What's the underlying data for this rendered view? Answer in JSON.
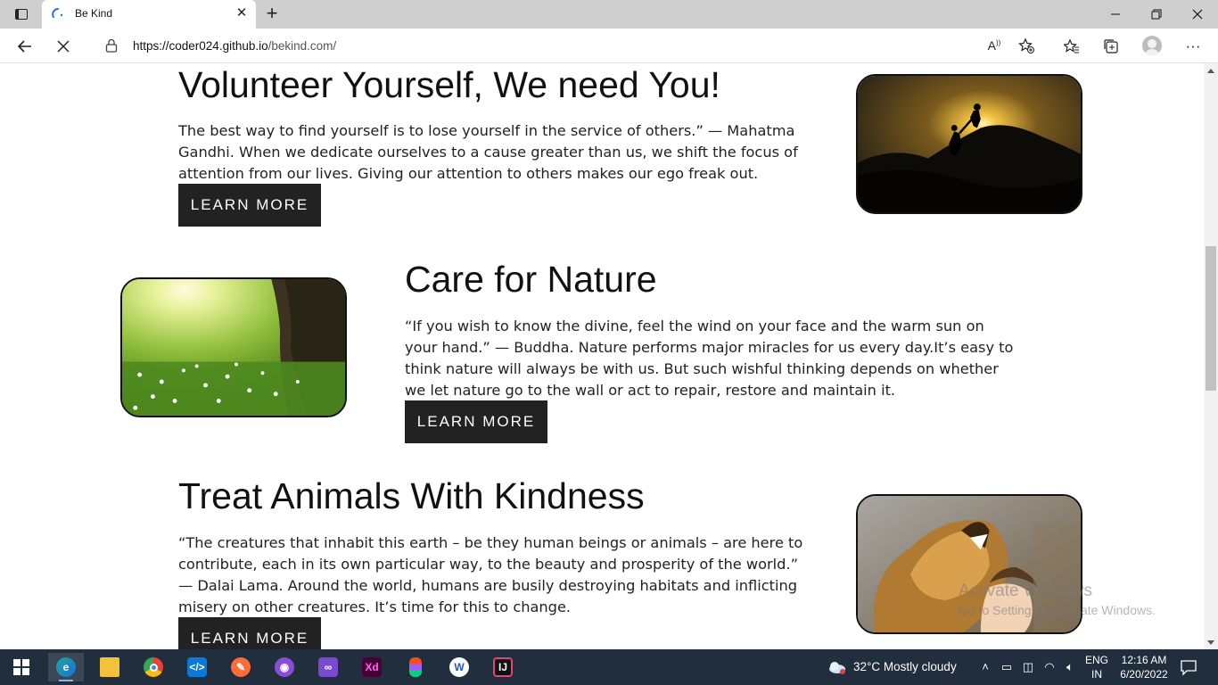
{
  "browser": {
    "tab_title": "Be Kind",
    "url_host": "https://coder024.github.io",
    "url_path": "/bekind.com/"
  },
  "sections": [
    {
      "title": "Volunteer Yourself, We need You!",
      "text": "The best way to find yourself is to lose yourself in the service of others.” — Mahatma Gandhi. When we dedicate ourselves to a cause greater than us, we shift the focus of attention from our lives. Giving our attention to others makes our ego freak out.",
      "button": "LEARN MORE",
      "image": "silhouettes helping each other climb at sunset"
    },
    {
      "title": "Care for Nature",
      "text": "“If you wish to know the divine, feel the wind on your face and the warm sun on your hand.” — Buddha. Nature performs major miracles for us every day.It’s easy to think nature will always be with us. But such wishful thinking depends on whether we let nature go to the wall or act to repair, restore and maintain it.",
      "button": "LEARN MORE",
      "image": "sunlit meadow with white flowers and tree"
    },
    {
      "title": "Treat Animals With Kindness",
      "text": "“The creatures that inhabit this earth – be they human beings or animals – are here to contribute, each in its own particular way, to the beauty and prosperity of the world.” — Dalai Lama. Around the world, humans are busily destroying habitats and inflicting misery on other creatures. It’s time for this to change.",
      "button": "LEARN MORE",
      "image": "lion roaring beside a smiling person"
    }
  ],
  "watermark": {
    "line1": "Activate Windows",
    "line2": "Go to Settings to activate Windows."
  },
  "taskbar": {
    "weather": "32°C  Mostly cloudy",
    "lang_top": "ENG",
    "lang_bottom": "IN",
    "time": "12:16 AM",
    "date": "6/20/2022",
    "apps": [
      "edge-icon",
      "file-explorer-icon",
      "chrome-icon",
      "vscode-icon",
      "postman-icon",
      "github-desktop-icon",
      "visual-studio-icon",
      "adobe-xd-icon",
      "figma-icon",
      "word-icon",
      "intellij-icon"
    ]
  },
  "colors": {
    "taskbar": "#202e3e",
    "button": "#222222",
    "tabbar": "#cfcfcf"
  }
}
